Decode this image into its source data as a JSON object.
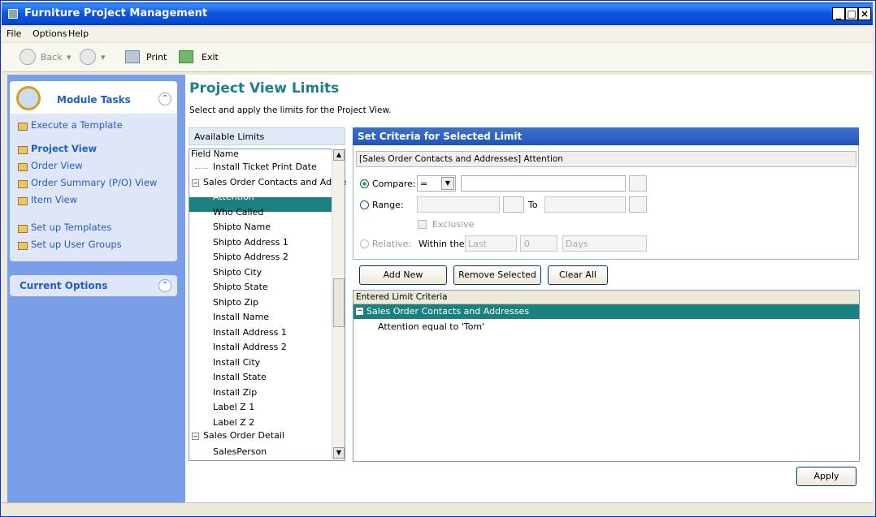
{
  "window": {
    "title": "Furniture Project Management"
  },
  "menu": [
    "File",
    "Options",
    "Help"
  ],
  "toolbar": {
    "back": "Back",
    "print": "Print",
    "exit": "Exit"
  },
  "module_tasks": {
    "title": "Module Tasks",
    "items": [
      "Execute a Template",
      "Project View",
      "Order View",
      "Order Summary (P/O) View",
      "Item View",
      "Set up Templates",
      "Set up User Groups"
    ]
  },
  "current_options": {
    "title": "Current Options"
  },
  "page": {
    "title": "Project View Limits",
    "subtitle": "Select and apply the limits for the Project View."
  },
  "available_limits": {
    "header": "Available Limits",
    "column": "Field Name",
    "items": [
      "Install Ticket Print Date",
      "Sales Order Contacts and Addre",
      "Attention",
      "Who Called",
      "Shipto Name",
      "Shipto Address 1",
      "Shipto Address 2",
      "Shipto City",
      "Shipto State",
      "Shipto Zip",
      "Install Name",
      "Install Address 1",
      "Install Address 2",
      "Install City",
      "Install State",
      "Install Zip",
      "Label Z 1",
      "Label Z 2",
      "Sales Order Detail",
      "SalesPerson"
    ]
  },
  "criteria": {
    "header": "Set Criteria for Selected Limit",
    "selected": "[Sales Order Contacts and Addresses] Attention",
    "compare_label": "Compare:",
    "compare_op": "=",
    "range_label": "Range:",
    "to_label": "To",
    "exclusive_label": "Exclusive",
    "relative_label": "Relative:",
    "within_label": "Within the",
    "last": "Last",
    "num": "0",
    "unit": "Days"
  },
  "buttons": {
    "add_new": "Add New",
    "remove_selected": "Remove Selected",
    "clear_all": "Clear All",
    "apply": "Apply"
  },
  "entered": {
    "header": "Entered Limit Criteria",
    "group": "Sales Order Contacts and Addresses",
    "item": "Attention equal to 'Tom'"
  }
}
